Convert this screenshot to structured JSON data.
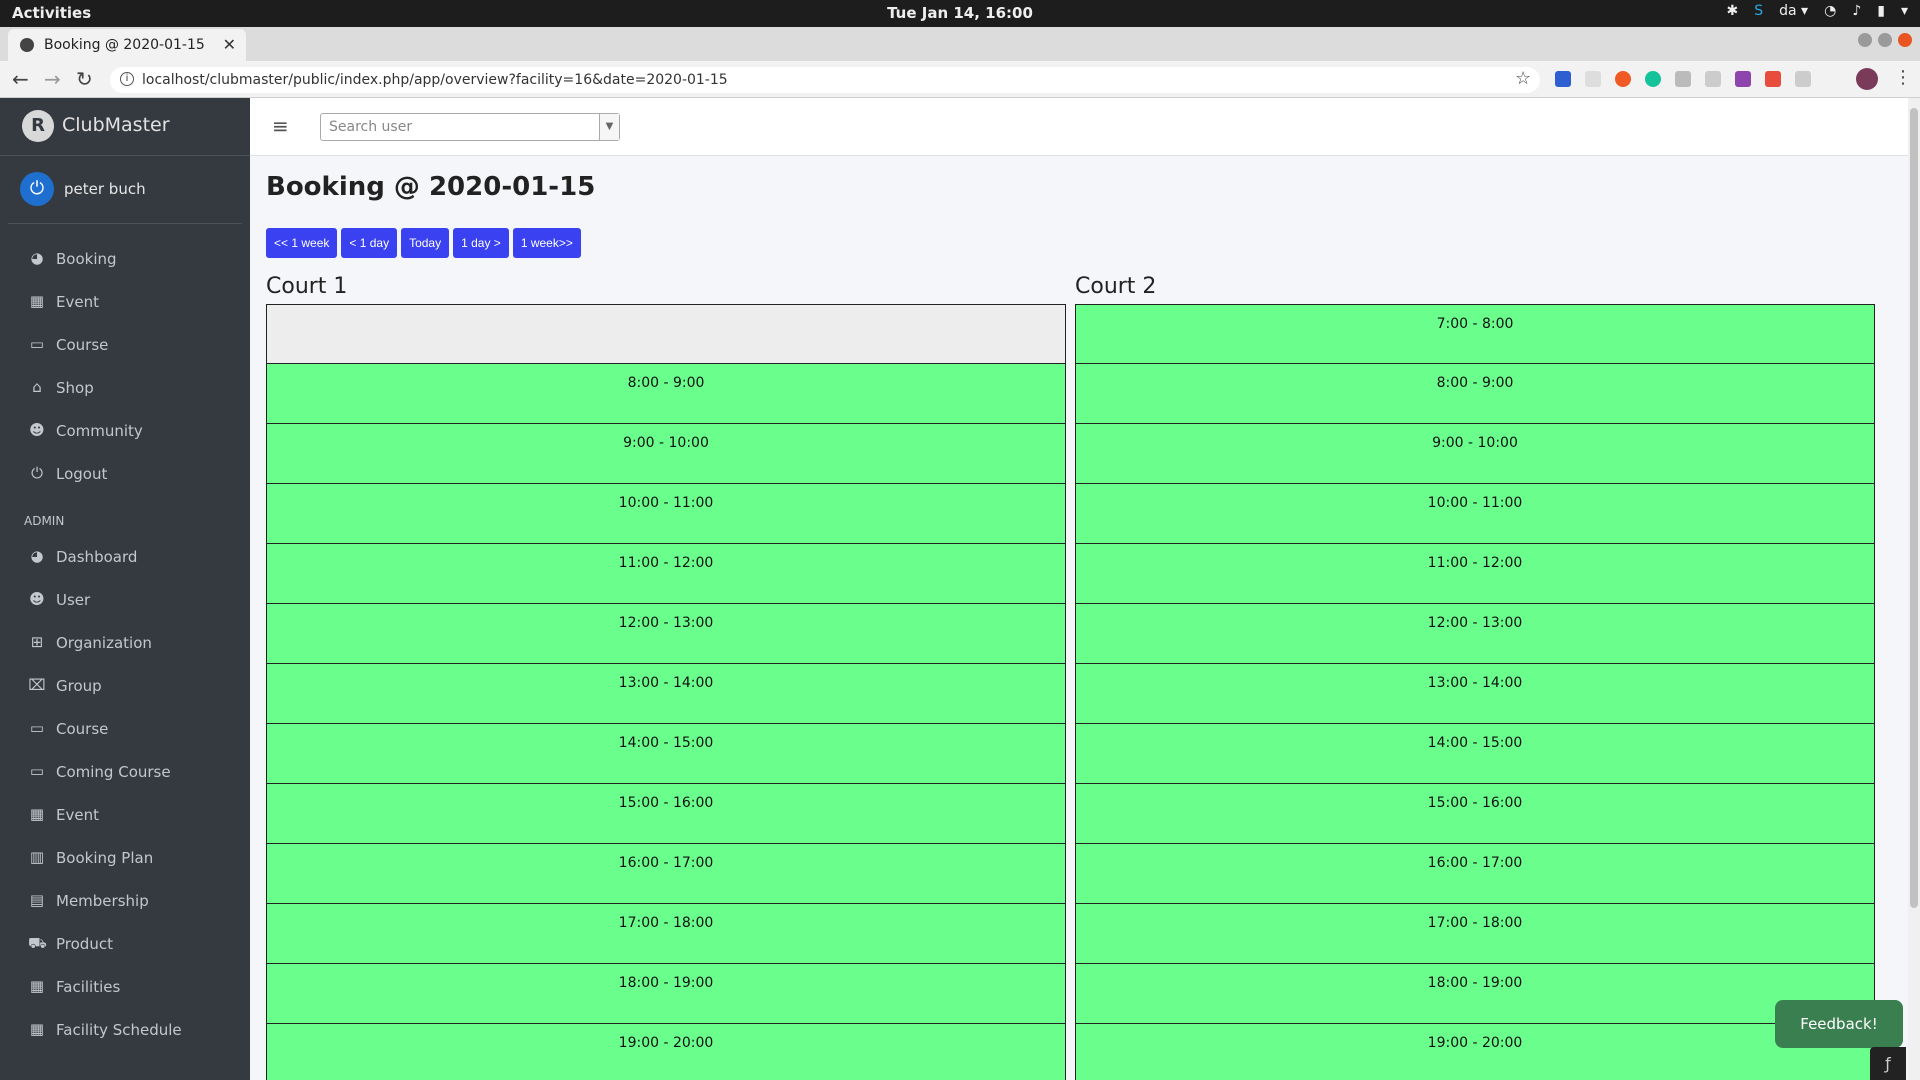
{
  "os": {
    "activities": "Activities",
    "clock": "Tue Jan 14, 16:00",
    "lang": "da ▾"
  },
  "browser": {
    "tab_title": "Booking @ 2020-01-15",
    "url": "localhost/clubmaster/public/index.php/app/overview?facility=16&date=2020-01-15"
  },
  "sidebar": {
    "brand": "ClubMaster",
    "user": "peter buch",
    "items": [
      {
        "label": "Booking",
        "icon": "tachometer-icon"
      },
      {
        "label": "Event",
        "icon": "calendar-icon"
      },
      {
        "label": "Course",
        "icon": "chalkboard-icon"
      },
      {
        "label": "Shop",
        "icon": "store-icon"
      },
      {
        "label": "Community",
        "icon": "users-icon"
      },
      {
        "label": "Logout",
        "icon": "power-icon"
      }
    ],
    "admin_header": "ADMIN",
    "admin_items": [
      {
        "label": "Dashboard",
        "icon": "tachometer-icon"
      },
      {
        "label": "User",
        "icon": "users-icon"
      },
      {
        "label": "Organization",
        "icon": "sitemap-icon"
      },
      {
        "label": "Group",
        "icon": "group-icon"
      },
      {
        "label": "Course",
        "icon": "laptop-icon"
      },
      {
        "label": "Coming Course",
        "icon": "chalkboard-icon"
      },
      {
        "label": "Event",
        "icon": "calendar-icon"
      },
      {
        "label": "Booking Plan",
        "icon": "table-icon"
      },
      {
        "label": "Membership",
        "icon": "id-card-icon"
      },
      {
        "label": "Product",
        "icon": "cart-icon"
      },
      {
        "label": "Facilities",
        "icon": "grid-icon"
      },
      {
        "label": "Facility Schedule",
        "icon": "grid-icon"
      }
    ]
  },
  "topnav": {
    "search_placeholder": "Search user"
  },
  "page": {
    "title": "Booking @ 2020-01-15",
    "buttons": [
      "<< 1 week",
      "< 1 day",
      "Today",
      "1 day >",
      "1 week>>"
    ]
  },
  "courts": [
    {
      "name": "Court 1",
      "slots": [
        "",
        "8:00 - 9:00",
        "9:00 - 10:00",
        "10:00 - 11:00",
        "11:00 - 12:00",
        "12:00 - 13:00",
        "13:00 - 14:00",
        "14:00 - 15:00",
        "15:00 - 16:00",
        "16:00 - 17:00",
        "17:00 - 18:00",
        "18:00 - 19:00",
        "19:00 - 20:00"
      ]
    },
    {
      "name": "Court 2",
      "slots": [
        "7:00 - 8:00",
        "8:00 - 9:00",
        "9:00 - 10:00",
        "10:00 - 11:00",
        "11:00 - 12:00",
        "12:00 - 13:00",
        "13:00 - 14:00",
        "14:00 - 15:00",
        "15:00 - 16:00",
        "16:00 - 17:00",
        "17:00 - 18:00",
        "18:00 - 19:00",
        "19:00 - 20:00"
      ]
    }
  ],
  "feedback": "Feedback!",
  "colors": {
    "sidebar": "#343a40",
    "button": "#3a41f0",
    "available_slot": "#6aff8d",
    "unavailable_slot": "#ededed"
  }
}
